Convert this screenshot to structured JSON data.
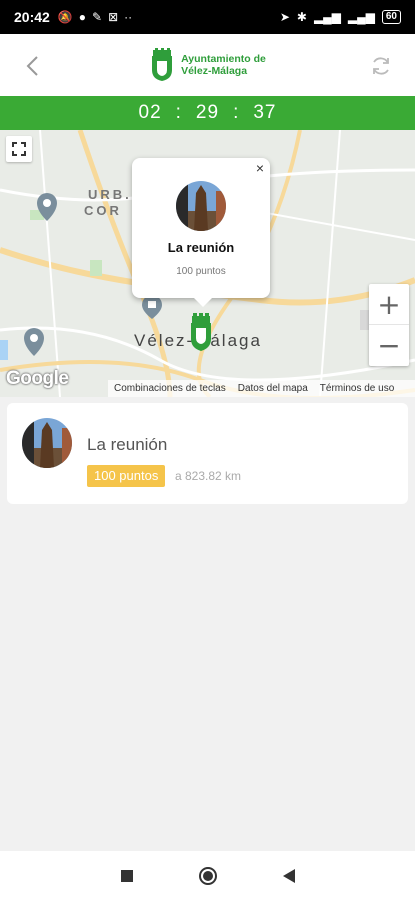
{
  "status_bar": {
    "time": "20:42",
    "battery": "60"
  },
  "header": {
    "logo_line1": "Ayuntamiento de",
    "logo_line2": "Vélez-Málaga"
  },
  "timer": {
    "hours": "02",
    "minutes": "29",
    "seconds": "37",
    "separator": ":"
  },
  "map": {
    "label_urb": "URB.",
    "label_cor": "COR",
    "city_label": "Vélez-Málaga",
    "google": "Google",
    "attribution": [
      "Combinaciones de teclas",
      "Datos del mapa",
      "Términos de uso"
    ],
    "zoom_in": "+",
    "zoom_out": "−"
  },
  "popup": {
    "close": "×",
    "title": "La reunión",
    "points": "100 puntos"
  },
  "card": {
    "title": "La reunión",
    "badge": "100 puntos",
    "distance": "a 823.82 km"
  },
  "colors": {
    "brand_green": "#3aaa35",
    "badge_yellow": "#f5c44a"
  }
}
